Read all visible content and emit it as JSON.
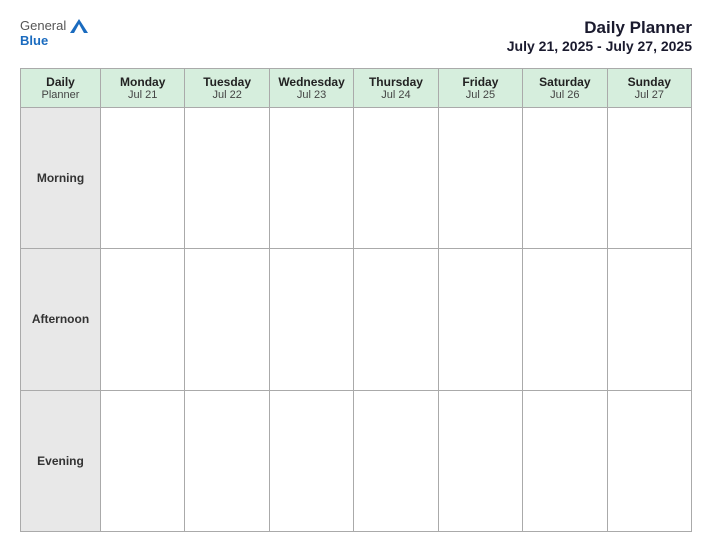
{
  "header": {
    "logo_general": "General",
    "logo_blue": "Blue",
    "title_line1": "Daily Planner",
    "title_line2": "July 21, 2025 - July 27, 2025"
  },
  "table": {
    "label_column": "Daily\nPlanner",
    "days": [
      {
        "name": "Monday",
        "date": "Jul 21"
      },
      {
        "name": "Tuesday",
        "date": "Jul 22"
      },
      {
        "name": "Wednesday",
        "date": "Jul 23"
      },
      {
        "name": "Thursday",
        "date": "Jul 24"
      },
      {
        "name": "Friday",
        "date": "Jul 25"
      },
      {
        "name": "Saturday",
        "date": "Jul 26"
      },
      {
        "name": "Sunday",
        "date": "Jul 27"
      }
    ],
    "rows": [
      {
        "label": "Morning"
      },
      {
        "label": "Afternoon"
      },
      {
        "label": "Evening"
      }
    ]
  }
}
